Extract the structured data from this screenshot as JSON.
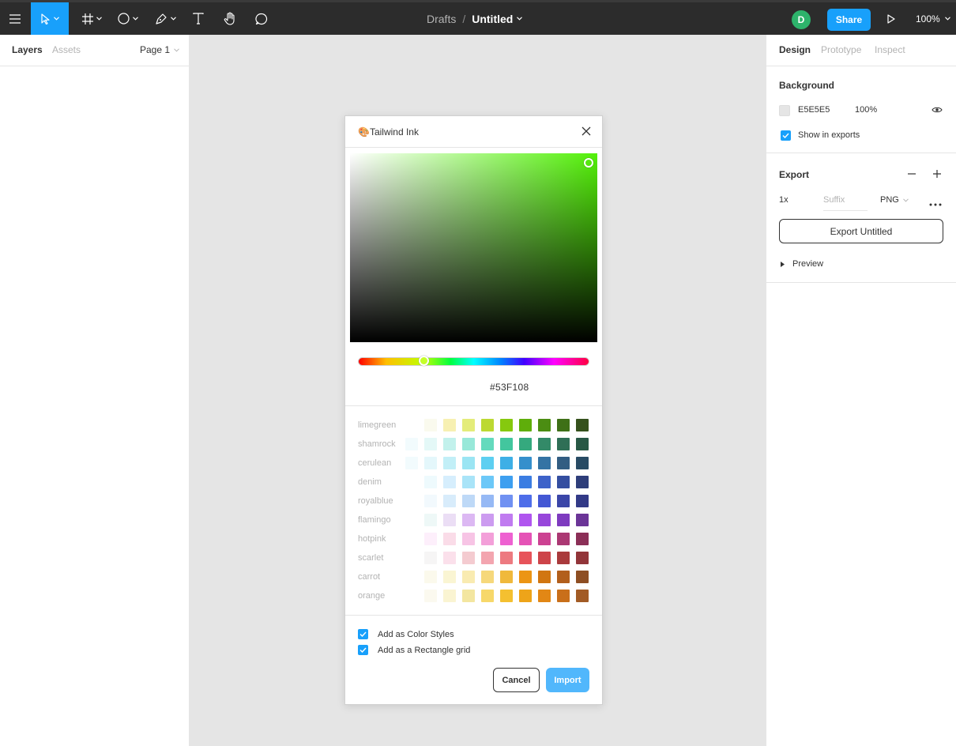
{
  "toolbar": {
    "breadcrumb": "Drafts",
    "separator": "/",
    "title": "Untitled",
    "avatar_letter": "D",
    "share_label": "Share",
    "zoom": "100%"
  },
  "left_panel": {
    "tabs": [
      "Layers",
      "Assets"
    ],
    "page_selector": "Page 1"
  },
  "right_panel": {
    "tabs": [
      "Design",
      "Prototype",
      "Inspect"
    ],
    "background": {
      "title": "Background",
      "hex": "E5E5E5",
      "opacity": "100%",
      "show_in_exports": "Show in exports"
    },
    "export": {
      "title": "Export",
      "scale": "1x",
      "suffix_placeholder": "Suffix",
      "format": "PNG",
      "button": "Export Untitled",
      "preview": "Preview"
    }
  },
  "dialog": {
    "title": "🎨Tailwind Ink",
    "hex": "#53F108",
    "palettes": [
      {
        "name": "limegreen",
        "colors": [
          "#ffffff",
          "#fafaee",
          "#f7f0b2",
          "#e4ec7a",
          "#bcd932",
          "#86c90e",
          "#5fae0a",
          "#4b8d12",
          "#3e7017",
          "#35511c"
        ]
      },
      {
        "name": "shamrock",
        "colors": [
          "#f2fbfd",
          "#e4f8f7",
          "#c2f1ec",
          "#98e8d9",
          "#64dabd",
          "#43c69e",
          "#35a97e",
          "#338a68",
          "#2f6f56",
          "#285845"
        ]
      },
      {
        "name": "cerulean",
        "colors": [
          "#f2fbfd",
          "#e4f7fb",
          "#c2eff7",
          "#9be5f3",
          "#5dcff1",
          "#3eafe6",
          "#358fcc",
          "#3473a4",
          "#325d82",
          "#284b64"
        ]
      },
      {
        "name": "denim",
        "colors": [
          "#ffffff",
          "#eefafd",
          "#d6eefd",
          "#a9e4f8",
          "#6cc8f8",
          "#3e9ff0",
          "#3b7de2",
          "#3d62c9",
          "#344ea0",
          "#2e3e7a"
        ]
      },
      {
        "name": "royalblue",
        "colors": [
          "#ffffff",
          "#f2f9fd",
          "#d8ecfb",
          "#bed9f7",
          "#96b9f5",
          "#7091f2",
          "#4e6ee9",
          "#4458d4",
          "#3b46a8",
          "#323a87"
        ]
      },
      {
        "name": "flamingo",
        "colors": [
          "#ffffff",
          "#eef8f7",
          "#ebdef5",
          "#dcb8f3",
          "#cc9bf0",
          "#c07bf0",
          "#b055ef",
          "#9847db",
          "#7e3bbf",
          "#6b3597"
        ]
      },
      {
        "name": "hotpink",
        "colors": [
          "#ffffff",
          "#fdeffb",
          "#fadce8",
          "#f7c4e5",
          "#f39fd9",
          "#ee61d1",
          "#e553b6",
          "#cc4292",
          "#ab3873",
          "#8b2f57"
        ]
      },
      {
        "name": "scarlet",
        "colors": [
          "#ffffff",
          "#f6f5f5",
          "#fbe0eb",
          "#f4cbd0",
          "#f3a5af",
          "#ed7a80",
          "#e7535a",
          "#cd4449",
          "#a93a3c",
          "#923539"
        ]
      },
      {
        "name": "carrot",
        "colors": [
          "#ffffff",
          "#fbf9ec",
          "#faf5d3",
          "#f9ebb1",
          "#f6d87b",
          "#f0b93c",
          "#ec9514",
          "#d17611",
          "#b25f1c",
          "#8e4e23"
        ]
      },
      {
        "name": "orange",
        "colors": [
          "#ffffff",
          "#fbf9ef",
          "#faf4d2",
          "#f3e6a0",
          "#f7d86a",
          "#f4c030",
          "#eea419",
          "#e28715",
          "#c96f1a",
          "#a25b25"
        ]
      }
    ],
    "options": [
      "Add as Color Styles",
      "Add as a Rectangle grid"
    ],
    "cancel": "Cancel",
    "import": "Import"
  },
  "colors": {
    "accent": "#18a0fb",
    "toolbar_bg": "#2c2c2c",
    "canvas_bg": "#e5e5e5",
    "avatar": "#2db36b",
    "selected_color": "#53f108"
  }
}
